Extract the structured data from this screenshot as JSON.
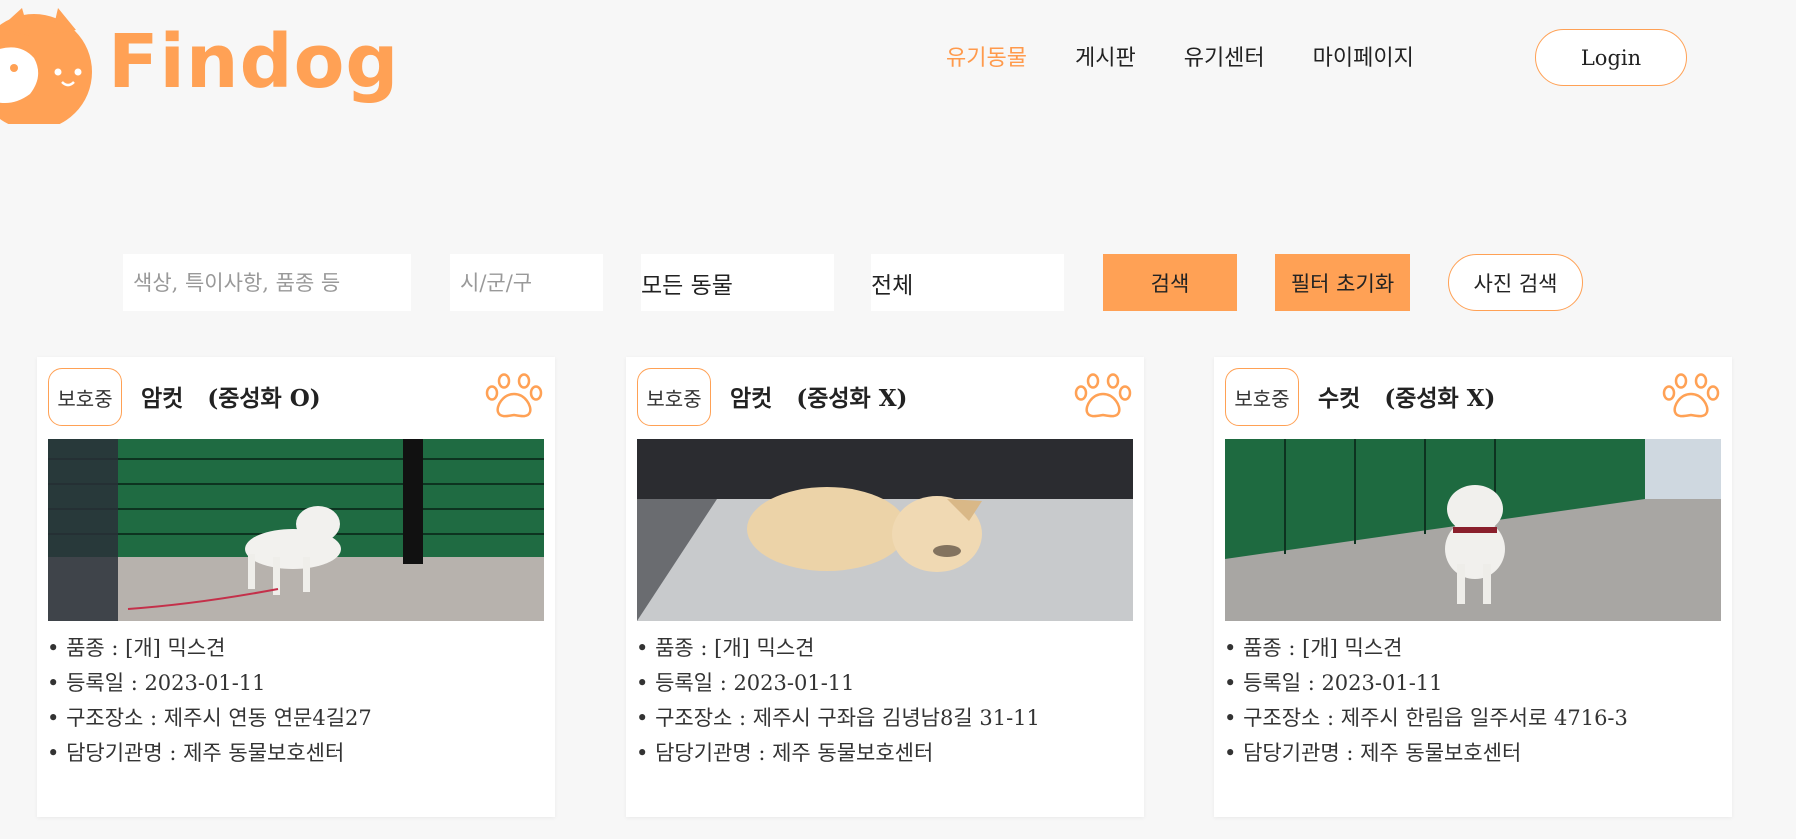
{
  "header": {
    "logo_text": "Findog",
    "nav": [
      "유기동물",
      "게시판",
      "유기센터",
      "마이페이지"
    ],
    "active_nav": "유기동물",
    "login_label": "Login"
  },
  "search": {
    "keyword_placeholder": "색상, 특이사항, 품종 등",
    "region_placeholder": "시/군/구",
    "animal_select": "모든 동물",
    "status_select": "전체",
    "search_label": "검색",
    "reset_label": "필터 초기화",
    "photo_search_label": "사진 검색"
  },
  "colors": {
    "accent": "#ffa155",
    "background": "#f7f7f7"
  },
  "cards": [
    {
      "status": "보호중",
      "title": "암컷   (중성화 O)",
      "breed": "품종 : [개] 믹스견",
      "date": "등록일 : 2023-01-11",
      "place": "구조장소 : 제주시 연동 연문4길27",
      "agency": "담당기관명 : 제주 동물보호센터"
    },
    {
      "status": "보호중",
      "title": "암컷   (중성화 X)",
      "breed": "품종 : [개] 믹스견",
      "date": "등록일 : 2023-01-11",
      "place": "구조장소 : 제주시 구좌읍 김녕남8길 31-11",
      "agency": "담당기관명 : 제주 동물보호센터"
    },
    {
      "status": "보호중",
      "title": "수컷   (중성화 X)",
      "breed": "품종 : [개] 믹스견",
      "date": "등록일 : 2023-01-11",
      "place": "구조장소 : 제주시 한림읍 일주서로 4716-3",
      "agency": "담당기관명 : 제주 동물보호센터"
    }
  ]
}
